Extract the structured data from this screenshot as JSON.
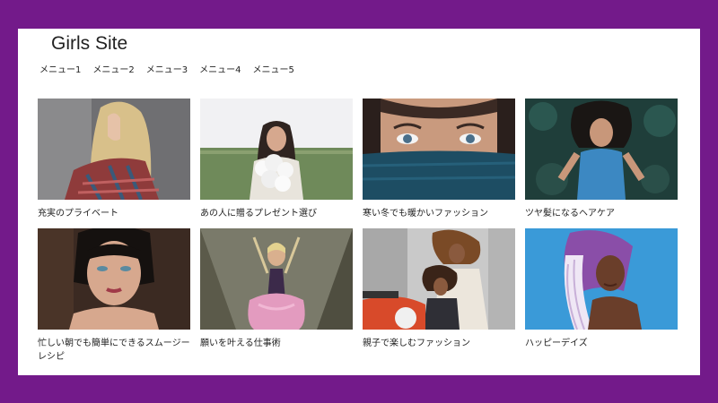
{
  "site": {
    "title": "Girls Site"
  },
  "nav": {
    "items": [
      "メニュー1",
      "メニュー2",
      "メニュー3",
      "メニュー4",
      "メニュー5"
    ]
  },
  "articles": [
    {
      "caption": "充実のプライベート",
      "image": "woman-blonde-plaid-shirt"
    },
    {
      "caption": "あの人に贈るプレゼント選び",
      "image": "woman-holding-flowers-field"
    },
    {
      "caption": "寒い冬でも暖かいファッション",
      "image": "woman-eyes-blue-scarf"
    },
    {
      "caption": "ツヤ髪になるヘアケア",
      "image": "woman-lying-on-leaves"
    },
    {
      "caption": "忙しい朝でも簡単にできるスムージーレシピ",
      "image": "woman-bangs-portrait"
    },
    {
      "caption": "願いを叶える仕事術",
      "image": "woman-praying-pink-skirt"
    },
    {
      "caption": "親子で楽しむファッション",
      "image": "mother-daughter-scooter"
    },
    {
      "caption": "ハッピーデイズ",
      "image": "woman-headscarf-blue-bg"
    }
  ]
}
